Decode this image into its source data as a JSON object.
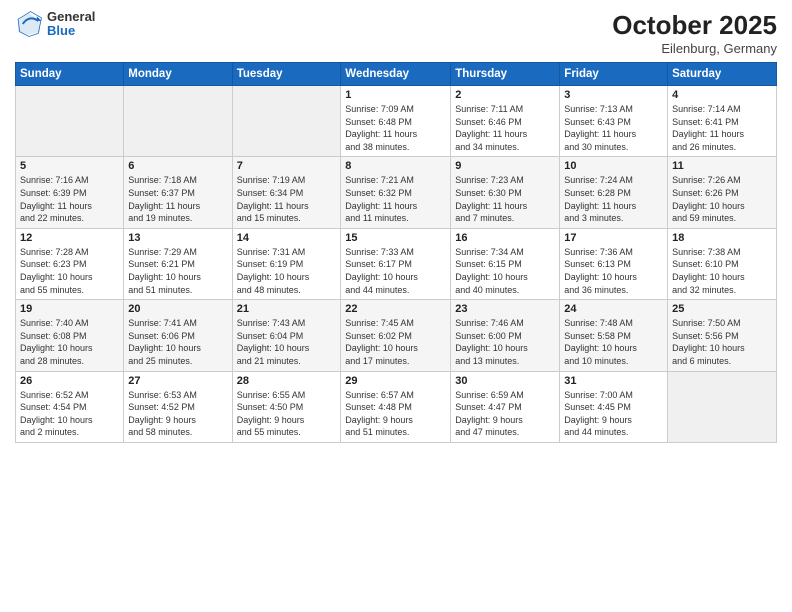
{
  "logo": {
    "general": "General",
    "blue": "Blue"
  },
  "title": "October 2025",
  "subtitle": "Eilenburg, Germany",
  "days_of_week": [
    "Sunday",
    "Monday",
    "Tuesday",
    "Wednesday",
    "Thursday",
    "Friday",
    "Saturday"
  ],
  "weeks": [
    [
      {
        "day": "",
        "info": ""
      },
      {
        "day": "",
        "info": ""
      },
      {
        "day": "",
        "info": ""
      },
      {
        "day": "1",
        "info": "Sunrise: 7:09 AM\nSunset: 6:48 PM\nDaylight: 11 hours\nand 38 minutes."
      },
      {
        "day": "2",
        "info": "Sunrise: 7:11 AM\nSunset: 6:46 PM\nDaylight: 11 hours\nand 34 minutes."
      },
      {
        "day": "3",
        "info": "Sunrise: 7:13 AM\nSunset: 6:43 PM\nDaylight: 11 hours\nand 30 minutes."
      },
      {
        "day": "4",
        "info": "Sunrise: 7:14 AM\nSunset: 6:41 PM\nDaylight: 11 hours\nand 26 minutes."
      }
    ],
    [
      {
        "day": "5",
        "info": "Sunrise: 7:16 AM\nSunset: 6:39 PM\nDaylight: 11 hours\nand 22 minutes."
      },
      {
        "day": "6",
        "info": "Sunrise: 7:18 AM\nSunset: 6:37 PM\nDaylight: 11 hours\nand 19 minutes."
      },
      {
        "day": "7",
        "info": "Sunrise: 7:19 AM\nSunset: 6:34 PM\nDaylight: 11 hours\nand 15 minutes."
      },
      {
        "day": "8",
        "info": "Sunrise: 7:21 AM\nSunset: 6:32 PM\nDaylight: 11 hours\nand 11 minutes."
      },
      {
        "day": "9",
        "info": "Sunrise: 7:23 AM\nSunset: 6:30 PM\nDaylight: 11 hours\nand 7 minutes."
      },
      {
        "day": "10",
        "info": "Sunrise: 7:24 AM\nSunset: 6:28 PM\nDaylight: 11 hours\nand 3 minutes."
      },
      {
        "day": "11",
        "info": "Sunrise: 7:26 AM\nSunset: 6:26 PM\nDaylight: 10 hours\nand 59 minutes."
      }
    ],
    [
      {
        "day": "12",
        "info": "Sunrise: 7:28 AM\nSunset: 6:23 PM\nDaylight: 10 hours\nand 55 minutes."
      },
      {
        "day": "13",
        "info": "Sunrise: 7:29 AM\nSunset: 6:21 PM\nDaylight: 10 hours\nand 51 minutes."
      },
      {
        "day": "14",
        "info": "Sunrise: 7:31 AM\nSunset: 6:19 PM\nDaylight: 10 hours\nand 48 minutes."
      },
      {
        "day": "15",
        "info": "Sunrise: 7:33 AM\nSunset: 6:17 PM\nDaylight: 10 hours\nand 44 minutes."
      },
      {
        "day": "16",
        "info": "Sunrise: 7:34 AM\nSunset: 6:15 PM\nDaylight: 10 hours\nand 40 minutes."
      },
      {
        "day": "17",
        "info": "Sunrise: 7:36 AM\nSunset: 6:13 PM\nDaylight: 10 hours\nand 36 minutes."
      },
      {
        "day": "18",
        "info": "Sunrise: 7:38 AM\nSunset: 6:10 PM\nDaylight: 10 hours\nand 32 minutes."
      }
    ],
    [
      {
        "day": "19",
        "info": "Sunrise: 7:40 AM\nSunset: 6:08 PM\nDaylight: 10 hours\nand 28 minutes."
      },
      {
        "day": "20",
        "info": "Sunrise: 7:41 AM\nSunset: 6:06 PM\nDaylight: 10 hours\nand 25 minutes."
      },
      {
        "day": "21",
        "info": "Sunrise: 7:43 AM\nSunset: 6:04 PM\nDaylight: 10 hours\nand 21 minutes."
      },
      {
        "day": "22",
        "info": "Sunrise: 7:45 AM\nSunset: 6:02 PM\nDaylight: 10 hours\nand 17 minutes."
      },
      {
        "day": "23",
        "info": "Sunrise: 7:46 AM\nSunset: 6:00 PM\nDaylight: 10 hours\nand 13 minutes."
      },
      {
        "day": "24",
        "info": "Sunrise: 7:48 AM\nSunset: 5:58 PM\nDaylight: 10 hours\nand 10 minutes."
      },
      {
        "day": "25",
        "info": "Sunrise: 7:50 AM\nSunset: 5:56 PM\nDaylight: 10 hours\nand 6 minutes."
      }
    ],
    [
      {
        "day": "26",
        "info": "Sunrise: 6:52 AM\nSunset: 4:54 PM\nDaylight: 10 hours\nand 2 minutes."
      },
      {
        "day": "27",
        "info": "Sunrise: 6:53 AM\nSunset: 4:52 PM\nDaylight: 9 hours\nand 58 minutes."
      },
      {
        "day": "28",
        "info": "Sunrise: 6:55 AM\nSunset: 4:50 PM\nDaylight: 9 hours\nand 55 minutes."
      },
      {
        "day": "29",
        "info": "Sunrise: 6:57 AM\nSunset: 4:48 PM\nDaylight: 9 hours\nand 51 minutes."
      },
      {
        "day": "30",
        "info": "Sunrise: 6:59 AM\nSunset: 4:47 PM\nDaylight: 9 hours\nand 47 minutes."
      },
      {
        "day": "31",
        "info": "Sunrise: 7:00 AM\nSunset: 4:45 PM\nDaylight: 9 hours\nand 44 minutes."
      },
      {
        "day": "",
        "info": ""
      }
    ]
  ]
}
